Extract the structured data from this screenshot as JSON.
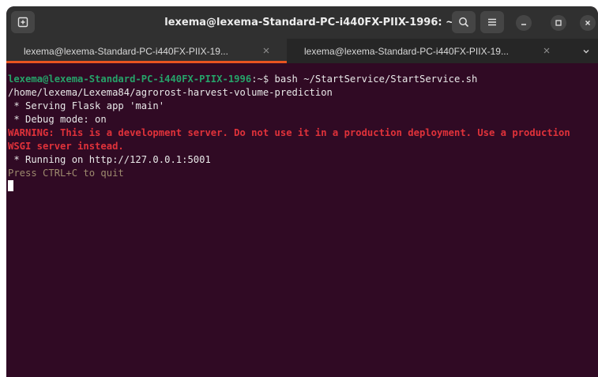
{
  "window": {
    "title": "lexema@lexema-Standard-PC-i440FX-PIIX-1996: ~"
  },
  "titlebar_icons": {
    "new_tab": "new-tab-icon",
    "search": "search-icon",
    "menu": "hamburger-menu-icon",
    "minimize": "minimize-icon",
    "maximize": "maximize-icon",
    "close": "close-icon"
  },
  "tabs": [
    {
      "label": "lexema@lexema-Standard-PC-i440FX-PIIX-19...",
      "active": true
    },
    {
      "label": "lexema@lexema-Standard-PC-i440FX-PIIX-19...",
      "active": false
    }
  ],
  "terminal": {
    "prompt_user": "lexema@lexema-Standard-PC-i440FX-PIIX-1996",
    "prompt_sep": ":~$ ",
    "command": "bash ~/StartService/StartService.sh",
    "lines": [
      "/home/lexema/Lexema84/agrorost-harvest-volume-prediction",
      " * Serving Flask app 'main'",
      " * Debug mode: on"
    ],
    "warning": "WARNING: This is a development server. Do not use it in a production deployment. Use a production WSGI server instead.",
    "running": " * Running on http://127.0.0.1:5001",
    "quit_hint": "Press CTRL+C to quit"
  },
  "colors": {
    "terminal_bg": "#300a24",
    "prompt_user": "#26a269",
    "warning": "#e0323a",
    "tab_accent": "#e95420"
  }
}
